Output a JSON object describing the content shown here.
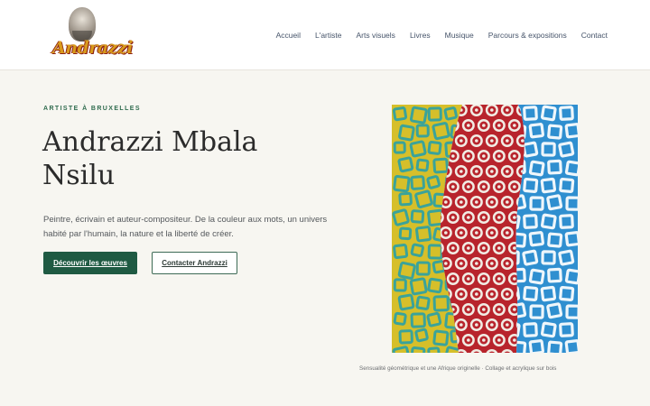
{
  "header": {
    "logo_text": "Andrazzi",
    "nav": [
      {
        "label": "Accueil"
      },
      {
        "label": "L'artiste"
      },
      {
        "label": "Arts visuels"
      },
      {
        "label": "Livres"
      },
      {
        "label": "Musique"
      },
      {
        "label": "Parcours & expositions"
      },
      {
        "label": "Contact"
      }
    ]
  },
  "hero": {
    "eyebrow": "ARTISTE À BRUXELLES",
    "title": "Andrazzi Mbala Nsilu",
    "lead": "Peintre, écrivain et auteur-compositeur. De la couleur aux mots, un univers habité par l'humain, la nature et la liberté de créer.",
    "primary_button": "Découvrir les œuvres",
    "secondary_button": "Contacter Andrazzi",
    "artwork_caption": "Sensualité géométrique et une Afrique originelle · Collage et acrylique sur bois"
  },
  "colors": {
    "accent": "#1f5a43",
    "background": "#f7f6f1",
    "art_yellow": "#d6bf2a",
    "art_red": "#b8242c",
    "art_blue": "#2f8fd0"
  }
}
